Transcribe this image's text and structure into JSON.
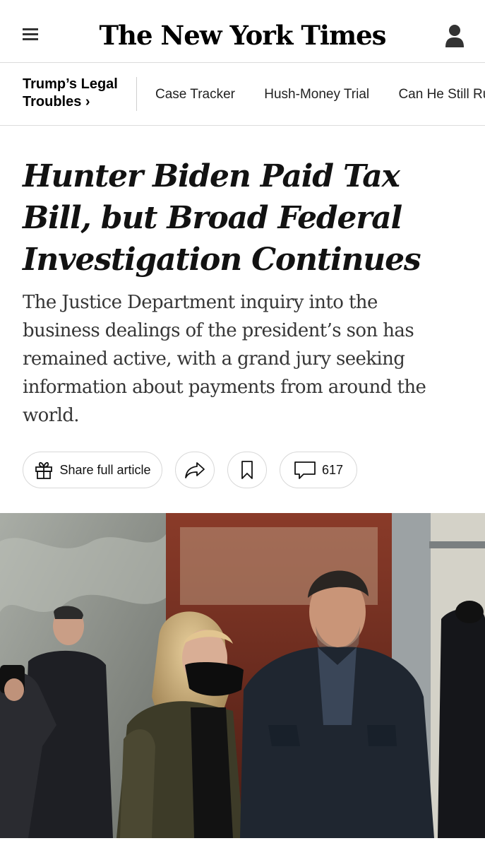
{
  "masthead": {
    "logo": "The New York Times",
    "menu_icon": "hamburger-menu-icon",
    "account_icon": "person-icon"
  },
  "nav": {
    "section_label": "Trump’s Legal Troubles ›",
    "links": [
      "Case Tracker",
      "Hush-Money Trial",
      "Can He Still Run?"
    ]
  },
  "article": {
    "headline": "Hunter Biden Paid Tax Bill, but Broad Federal Investigation Continues",
    "summary": "The Justice Department inquiry into the business dealings of the president’s son has remained active, with a grand jury seeking information about payments from around the world."
  },
  "actions": {
    "share_label": "Share full article",
    "comment_count": "617",
    "icons": [
      "gift-icon",
      "forward-arrow-icon",
      "bookmark-icon",
      "comment-bubble-icon"
    ]
  },
  "colors": {
    "text": "#121212",
    "summary": "#363636",
    "border": "#dcdcdc"
  }
}
